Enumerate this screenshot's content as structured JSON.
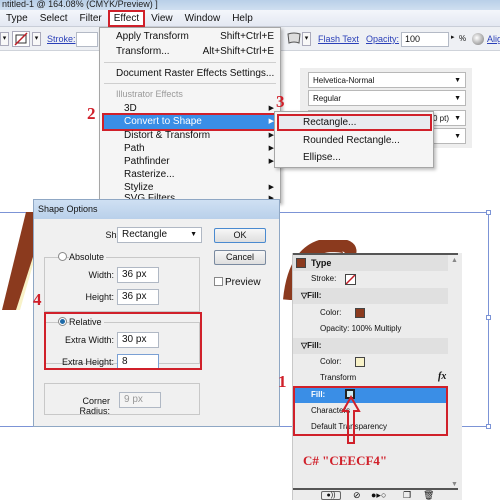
{
  "window": {
    "title": "ntitled-1 @ 164.08% (CMYK/Preview) ]"
  },
  "menubar": {
    "items": [
      "Type",
      "Select",
      "Filter",
      "Effect",
      "View",
      "Window",
      "Help"
    ],
    "active": "Effect"
  },
  "toolbar": {
    "stroke_label": "Stroke:",
    "flash_text_label": "Flash Text",
    "opacity_label": "Opacity:",
    "opacity_value": "100",
    "percent": "%",
    "align_label": "Alig"
  },
  "effect_menu": {
    "apply_transform": {
      "label": "Apply Transform",
      "shortcut": "Shift+Ctrl+E"
    },
    "transform": {
      "label": "Transform...",
      "shortcut": "Alt+Shift+Ctrl+E"
    },
    "doc_raster": "Document Raster Effects Settings...",
    "section_header": "Illustrator Effects",
    "items": [
      "3D",
      "Convert to Shape",
      "Distort & Transform",
      "Path",
      "Pathfinder",
      "Rasterize...",
      "Stylize",
      "SVG Filters"
    ],
    "highlighted": "Convert to Shape"
  },
  "submenu": {
    "items": [
      "Rectangle...",
      "Rounded Rectangle...",
      "Ellipse..."
    ],
    "highlighted": "Rectangle..."
  },
  "character_panel": {
    "font": "Helvetica-Normal",
    "style": "Regular",
    "size_partial": "0 pt)"
  },
  "steps": {
    "one": "1",
    "two": "2",
    "three": "3",
    "four": "4"
  },
  "dialog": {
    "title": "Shape Options",
    "shape_label": "Shape:",
    "shape_value": "Rectangle",
    "ok": "OK",
    "cancel": "Cancel",
    "preview": "Preview",
    "absolute_label": "Absolute",
    "width_label": "Width:",
    "width_value": "36 px",
    "height_label": "Height:",
    "height_value": "36 px",
    "relative_label": "Relative",
    "extra_width_label": "Extra Width:",
    "extra_width_value": "30 px",
    "extra_height_label": "Extra Height:",
    "extra_height_value": "8",
    "corner_radius_label": "Corner Radius:",
    "corner_radius_value": "9 px"
  },
  "appearance_panel": {
    "header": "Type",
    "stroke_label": "Stroke:",
    "fill1_label": "Fill:",
    "color_label": "Color:",
    "opacity_text": "Opacity: 100% Multiply",
    "fill2_label": "Fill:",
    "color2_label": "Color:",
    "transform_label": "Transform",
    "fx": "fx",
    "fill_selected_label": "Fill:",
    "characters_label": "Characters",
    "default_transparency_label": "Default Transparency",
    "annotation": "C# \"CEECF4\""
  },
  "colors": {
    "fill_brown": "#8B3A1E",
    "fill_cream": "#F8F2C8",
    "annotation_red": "#D0202A",
    "highlight_blue": "#3A8EE6"
  }
}
